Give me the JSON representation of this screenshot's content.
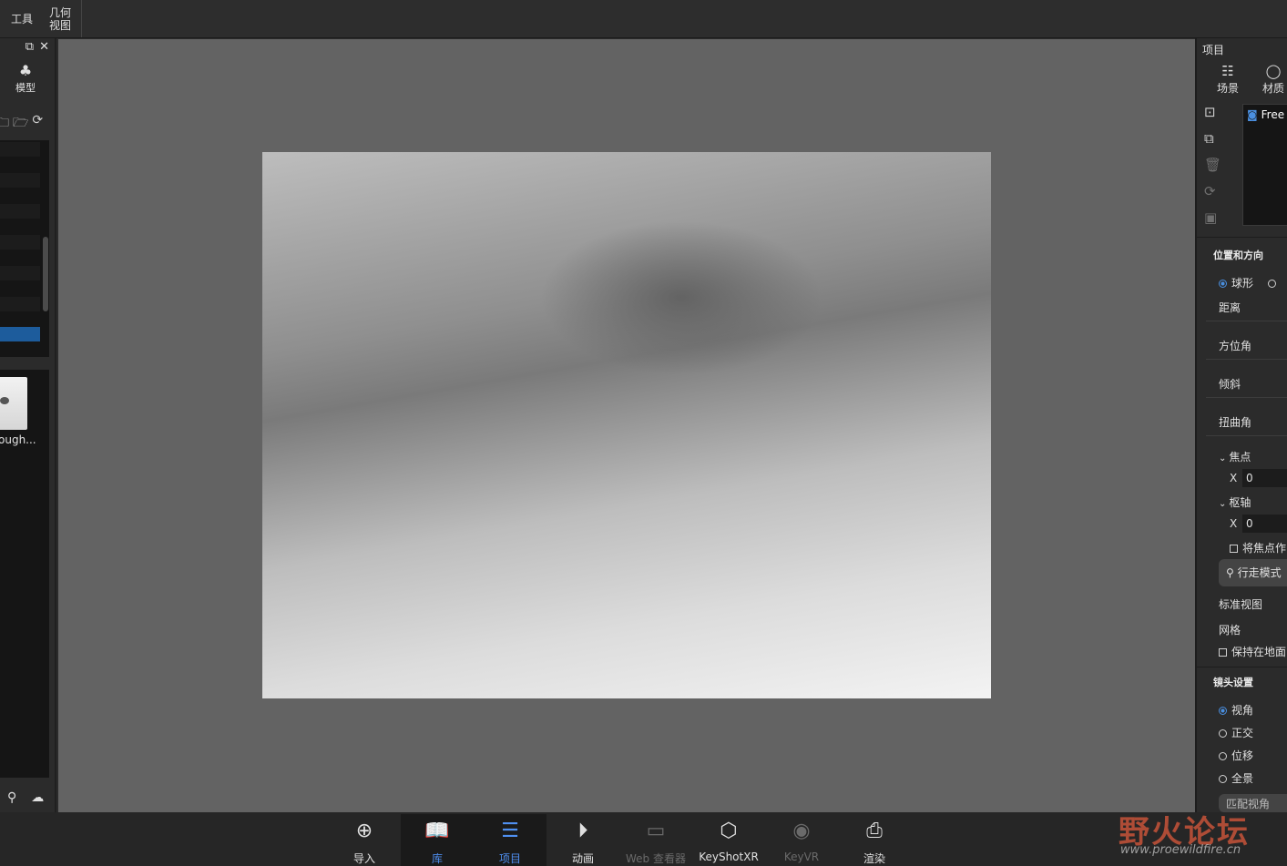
{
  "toolbar": {
    "tools_label": "工具",
    "geometry_view_label": "几何\n视图"
  },
  "left_panel": {
    "tab_label": "模型",
    "thumbnail_label": "ough..."
  },
  "right_panel": {
    "title": "项目",
    "tabs": [
      {
        "label": "场景",
        "icon": "scene-icon"
      },
      {
        "label": "材质",
        "icon": "material-icon"
      }
    ],
    "camera_item": "Free",
    "position_section": "位置和方向",
    "mode_sphere": "球形",
    "distance": "距离",
    "azimuth": "方位角",
    "tilt": "倾斜",
    "twist": "扭曲角",
    "focus_section": "焦点",
    "focus_x_label": "X",
    "focus_x_value": "0",
    "pivot_section": "枢轴",
    "pivot_x_label": "X",
    "pivot_x_value": "0",
    "set_focus_checkbox": "将焦点作",
    "walk_mode": "行走模式",
    "standard_view": "标准视图",
    "grid": "网格",
    "keep_ground": "保持在地面",
    "lens_section": "镜头设置",
    "lens_options": [
      "视角",
      "正交",
      "位移",
      "全景"
    ],
    "match_button": "匹配视角"
  },
  "bottom_bar": {
    "items": [
      {
        "label": "导入",
        "icon": "import-icon",
        "state": "normal"
      },
      {
        "label": "库",
        "icon": "library-icon",
        "state": "active"
      },
      {
        "label": "项目",
        "icon": "project-icon",
        "state": "active"
      },
      {
        "label": "动画",
        "icon": "animation-icon",
        "state": "normal"
      },
      {
        "label": "Web 查看器",
        "icon": "web-viewer-icon",
        "state": "disabled"
      },
      {
        "label": "KeyShotXR",
        "icon": "keyshotxr-icon",
        "state": "normal"
      },
      {
        "label": "KeyVR",
        "icon": "keyvr-icon",
        "state": "disabled"
      },
      {
        "label": "渲染",
        "icon": "render-icon",
        "state": "normal"
      }
    ]
  },
  "watermark": {
    "title": "野火论坛",
    "url": "www.proewildfire.cn"
  },
  "colors": {
    "accent": "#4f8ff0",
    "selection": "#1d5c9c",
    "viewport_bg": "#636363"
  }
}
